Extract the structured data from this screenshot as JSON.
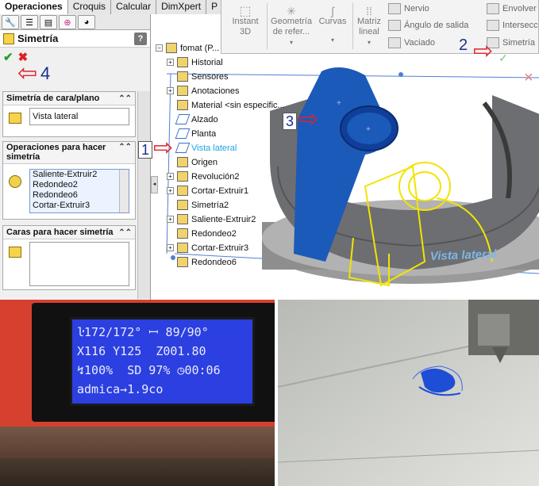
{
  "tabs": [
    "Operaciones",
    "Croquis",
    "Calcular",
    "DimXpert",
    "P"
  ],
  "ribbon": {
    "instant3d": "Instant\n3D",
    "geometria": "Geometría\nde refer...",
    "curvas": "Curvas",
    "matriz": "Matriz\nlineal",
    "nervio": "Nervio",
    "angulo": "Ángulo de salida",
    "vaciado": "Vaciado",
    "envolver": "Envolver",
    "interseccion": "Intersecc",
    "simetria": "Simetría"
  },
  "property_manager": {
    "title": "Simetría",
    "help": "?",
    "group1": {
      "title": "Simetría de cara/plano",
      "value": "Vista lateral"
    },
    "group2": {
      "title": "Operaciones para hacer simetría",
      "items": [
        "Saliente-Extruir2",
        "Redondeo2",
        "Redondeo6",
        "Cortar-Extruir3"
      ]
    },
    "group3": {
      "title": "Caras para hacer simetría"
    }
  },
  "tree": {
    "root": "fomat (P...",
    "items": [
      {
        "label": "Historial",
        "expand": true
      },
      {
        "label": "Sensores",
        "expand": false
      },
      {
        "label": "Anotaciones",
        "expand": true
      },
      {
        "label": "Material <sin especific...",
        "expand": false
      },
      {
        "label": "Alzado",
        "expand": false
      },
      {
        "label": "Planta",
        "expand": false
      },
      {
        "label": "Vista lateral",
        "expand": false,
        "highlight": true
      },
      {
        "label": "Origen",
        "expand": false
      },
      {
        "label": "Revolución2",
        "expand": true
      },
      {
        "label": "Cortar-Extruir1",
        "expand": true
      },
      {
        "label": "Simetría2",
        "expand": false
      },
      {
        "label": "Saliente-Extruir2",
        "expand": true
      },
      {
        "label": "Redondeo2",
        "expand": false
      },
      {
        "label": "Cortar-Extruir3",
        "expand": true
      },
      {
        "label": "Redondeo6",
        "expand": false
      }
    ]
  },
  "callouts": [
    "1",
    "2",
    "3",
    "4"
  ],
  "viewport": {
    "plane_label": "Vista lateral"
  },
  "lcd": {
    "lines": [
      "ŀ172/172° ꟷ 89/90°",
      "X116 Y125  Z001.80",
      "↯100%  SD 97% ◷00:06",
      "admica→1.9co"
    ]
  },
  "colors": {
    "accent": "#1da3e6",
    "callout_arrow": "#e0242a",
    "lcd_bg": "#2c3fe0",
    "part_blue": "#1b5ab8"
  }
}
